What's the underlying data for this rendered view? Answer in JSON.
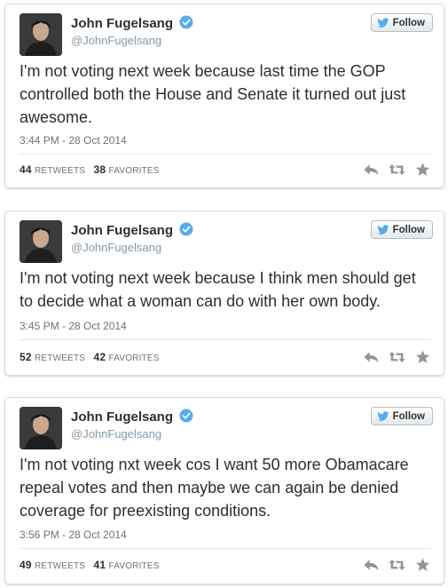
{
  "colors": {
    "verified_blue": "#55acee",
    "twitter_bird": "#55acee",
    "action_gray": "#8d969c",
    "text": "#292f33",
    "muted": "#66757f"
  },
  "tweets": [
    {
      "name": "John Fugelsang",
      "handle": "@JohnFugelsang",
      "follow_label": "Follow",
      "text": "I'm not voting next week because last time the GOP controlled both the House and Senate it turned out just awesome.",
      "timestamp": "3:44 PM - 28 Oct 2014",
      "retweets": "44",
      "retweets_label": "RETWEETS",
      "favorites": "38",
      "favorites_label": "FAVORITES"
    },
    {
      "name": "John Fugelsang",
      "handle": "@JohnFugelsang",
      "follow_label": "Follow",
      "text": "I'm not voting next week because I think men should get to decide what a woman can do with her own body.",
      "timestamp": "3:45 PM - 28 Oct 2014",
      "retweets": "52",
      "retweets_label": "RETWEETS",
      "favorites": "42",
      "favorites_label": "FAVORITES"
    },
    {
      "name": "John Fugelsang",
      "handle": "@JohnFugelsang",
      "follow_label": "Follow",
      "text": "I'm not voting nxt week cos I want 50 more Obamacare repeal votes and then maybe we can again be denied coverage for preexisting conditions.",
      "timestamp": "3:56 PM - 28 Oct 2014",
      "retweets": "49",
      "retweets_label": "RETWEETS",
      "favorites": "41",
      "favorites_label": "FAVORITES"
    }
  ]
}
